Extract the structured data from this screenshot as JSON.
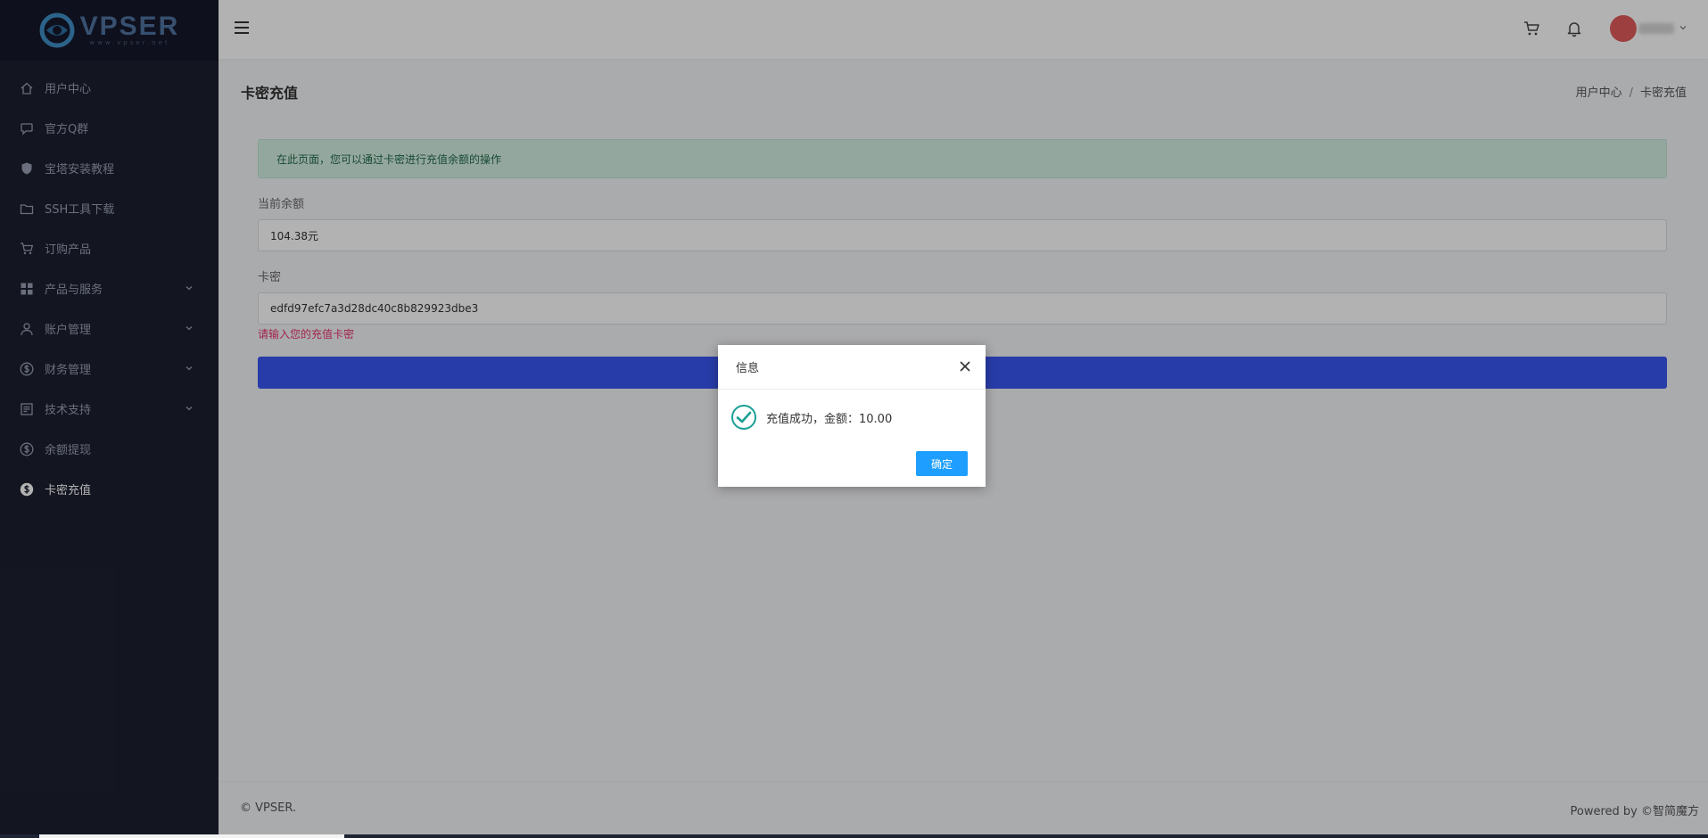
{
  "logo": {
    "text": "VPSER",
    "sub": "www.vpser.net"
  },
  "sidebar": {
    "items": [
      {
        "label": "用户中心",
        "icon": "home-icon",
        "has_children": false,
        "active": false
      },
      {
        "label": "官方Q群",
        "icon": "chat-icon",
        "has_children": false,
        "active": false
      },
      {
        "label": "宝塔安装教程",
        "icon": "shield-icon",
        "has_children": false,
        "active": false
      },
      {
        "label": "SSH工具下载",
        "icon": "folder-icon",
        "has_children": false,
        "active": false
      },
      {
        "label": "订购产品",
        "icon": "cart-icon",
        "has_children": false,
        "active": false
      },
      {
        "label": "产品与服务",
        "icon": "grid-icon",
        "has_children": true,
        "active": false
      },
      {
        "label": "账户管理",
        "icon": "user-icon",
        "has_children": true,
        "active": false
      },
      {
        "label": "财务管理",
        "icon": "dollar-circle-icon",
        "has_children": true,
        "active": false
      },
      {
        "label": "技术支持",
        "icon": "document-icon",
        "has_children": true,
        "active": false
      },
      {
        "label": "余额提现",
        "icon": "dollar-circle-icon",
        "has_children": false,
        "active": false
      },
      {
        "label": "卡密充值",
        "icon": "dollar-circle-icon",
        "has_children": false,
        "active": true
      }
    ]
  },
  "page": {
    "title": "卡密充值",
    "breadcrumb": [
      "用户中心",
      "卡密充值"
    ],
    "breadcrumb_sep": "/"
  },
  "alert": {
    "text": "在此页面，您可以通过卡密进行充值余额的操作"
  },
  "form": {
    "balance_label": "当前余额",
    "balance_value": "104.38元",
    "card_label": "卡密",
    "card_value": "edfd97efc7a3d28dc40c8b829923dbe3",
    "card_hint": "请输入您的充值卡密"
  },
  "footer": {
    "left": "© VPSER.",
    "right": "Powered by ©智简魔方"
  },
  "dialog": {
    "title": "信息",
    "message": "充值成功，金额：10.00",
    "ok_label": "确定"
  },
  "colors": {
    "sidebar_bg": "#1c1f30",
    "primary": "#3a56f2",
    "dialog_button": "#1e9fff",
    "success_icon": "#1aa094",
    "hint": "#e8336b"
  }
}
